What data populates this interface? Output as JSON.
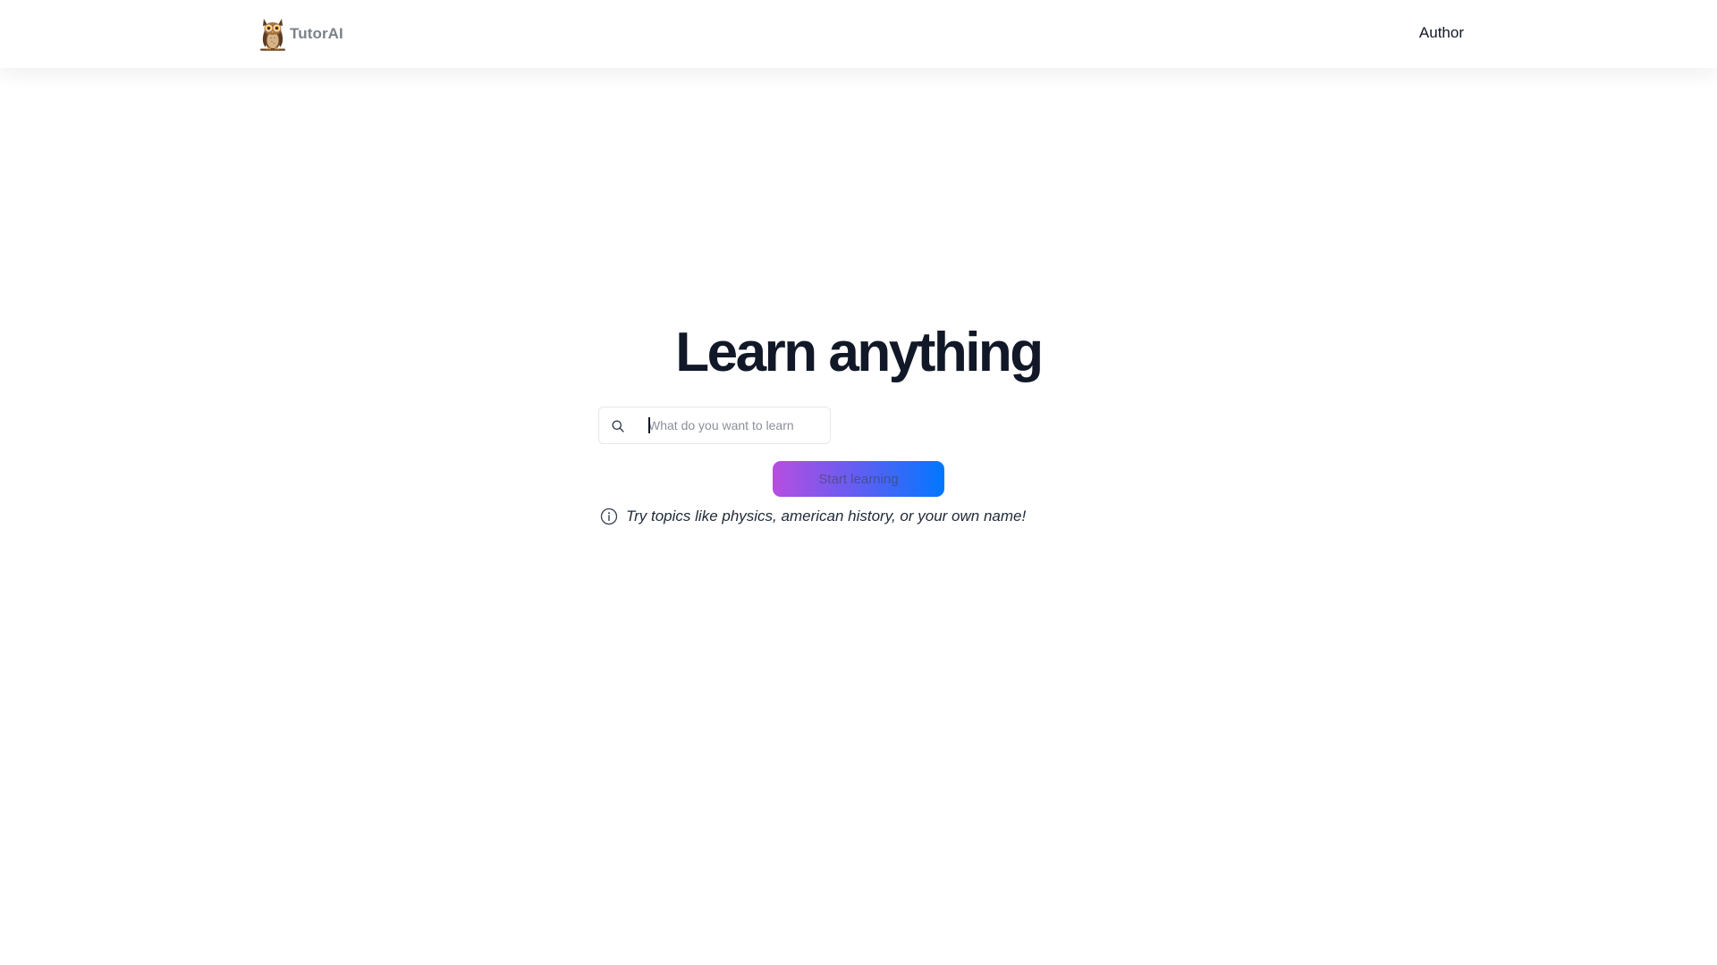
{
  "header": {
    "brand_name": "TutorAI",
    "brand_icon": "owl-icon",
    "nav_author": "Author"
  },
  "hero": {
    "title": "Learn anything"
  },
  "search": {
    "icon": "search-icon",
    "placeholder": "What do you want to learn",
    "value": ""
  },
  "start_button": {
    "label": "Start learning",
    "gradient_start": "#b64ee0",
    "gradient_end": "#0077ff"
  },
  "hint": {
    "icon": "info-icon",
    "text": "Try topics like physics, american history, or your own name!"
  },
  "colors": {
    "text_primary": "#111827",
    "brand_text": "#7b8189",
    "border": "#e5e7eb"
  }
}
